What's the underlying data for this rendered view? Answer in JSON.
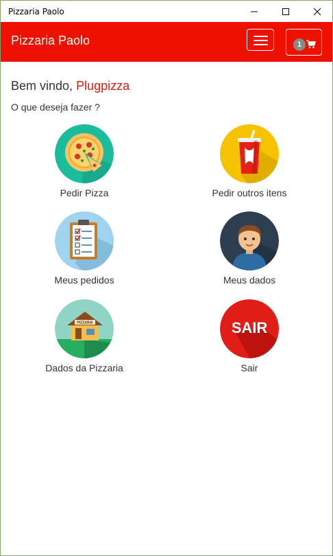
{
  "window": {
    "title": "Pizzaria Paolo"
  },
  "navbar": {
    "brand": "Pizzaria Paolo",
    "cart_count": "1",
    "accent_color": "#ee1100"
  },
  "greeting": {
    "prefix": "Bem vindo,",
    "username": "Plugpizza",
    "question": "O que deseja fazer ?"
  },
  "menu": [
    {
      "label": "Pedir Pizza",
      "icon": "pizza-icon"
    },
    {
      "label": "Pedir outros itens",
      "icon": "soda-cup-icon"
    },
    {
      "label": "Meus pedidos",
      "icon": "clipboard-checklist-icon"
    },
    {
      "label": "Meus dados",
      "icon": "user-avatar-icon"
    },
    {
      "label": "Dados da Pizzaria",
      "icon": "pizzeria-house-icon",
      "sign": "PIZZARIA"
    },
    {
      "label": "Sair",
      "icon": "exit-icon",
      "badge_text": "SAIR"
    }
  ]
}
